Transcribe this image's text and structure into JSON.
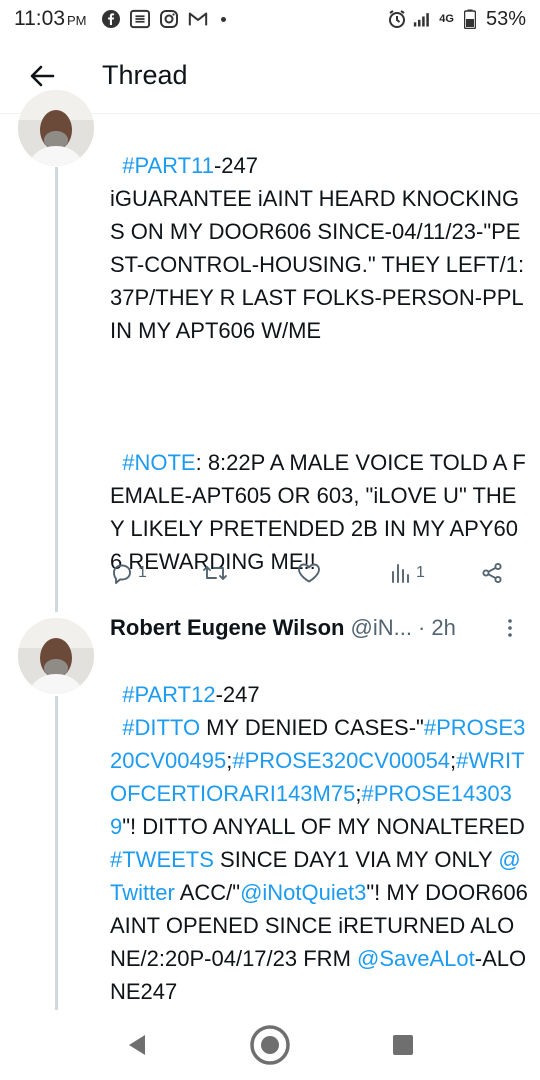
{
  "status_bar": {
    "time": "11:03",
    "ampm": "PM",
    "network_label": "4G",
    "battery": "53%"
  },
  "header": {
    "title": "Thread"
  },
  "tweets": [
    {
      "part_tag": "#PART11",
      "part_suffix": "-247",
      "body_1": "iGUARANTEE iAINT HEARD KNOCKINGS ON MY DOOR606 SINCE-04/11/23-\"PEST-CONTROL-HOUSING.\" THEY LEFT/1:37P/THEY R LAST FOLKS-PERSON-PPL IN MY APT606 W/ME",
      "note_tag": "#NOTE",
      "note_text": ": 8:22P A MALE VOICE TOLD A FEMALE-APT605 OR 603, \"iLOVE U\" THEY LIKELY PRETENDED 2B IN MY APY606 REWARDING ME!!",
      "reply_count": "1",
      "view_count": "1"
    },
    {
      "author_name": "Robert Eugene Wilson",
      "author_handle": "@iN...",
      "time": "· 2h",
      "part_tag": "#PART12",
      "part_suffix": "-247",
      "ditto_tag": "#DITTO",
      "line_2a": " MY DENIED CASES-\"",
      "case_1": "#PROSE320CV00495",
      "sep_1": ";",
      "case_2": "#PROSE320CV00054",
      "sep_2": ";",
      "case_3": "#WRITOFCERTIORARI143M75",
      "sep_3": ";",
      "case_4": "#PROSE143039",
      "line_3": "\"! DITTO ANYALL OF MY NONALTERED ",
      "tweets_tag": "#TWEETS",
      "line_4": " SINCE DAY1 VIA MY ONLY ",
      "twitter_mention": "@Twitter",
      "line_5": " ACC/\"",
      "self_mention": "@iNotQuiet3",
      "line_6": "\"! MY DOOR606 AINT OPENED SINCE iRETURNED ALONE/2:20P-04/17/23 FRM ",
      "store_mention": "@SaveALot",
      "line_7": "-ALONE247"
    }
  ],
  "colors": {
    "link": "#1d9bf0",
    "text": "#0f1419",
    "muted": "#536471",
    "thread_line": "#cfd9de"
  }
}
